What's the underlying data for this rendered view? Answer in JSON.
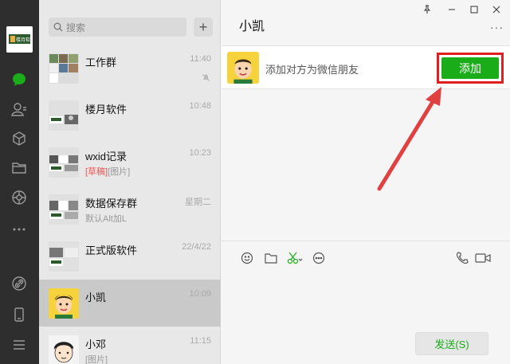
{
  "rail": {
    "logo_text": "楼月软件",
    "icons": [
      "chat-icon",
      "contacts-icon",
      "cube-icon",
      "folder-icon",
      "moments-icon",
      "more-icon",
      "link-icon",
      "phone-icon",
      "menu-icon"
    ]
  },
  "search": {
    "placeholder": "搜索",
    "add": "+"
  },
  "conversations": [
    {
      "name": "工作群",
      "time": "11:40",
      "msg": "",
      "draft": "",
      "muted": true
    },
    {
      "name": "楼月软件",
      "time": "10:48",
      "msg": "",
      "draft": "",
      "muted": false
    },
    {
      "name": "wxid记录",
      "time": "10:23",
      "msg": "[图片]",
      "draft": "[草稿]",
      "muted": false
    },
    {
      "name": "数据保存群",
      "time": "星期二",
      "msg": "默认Alt加L",
      "draft": "",
      "muted": false
    },
    {
      "name": "正式版软件",
      "time": "22/4/22",
      "msg": "",
      "draft": "",
      "muted": false
    },
    {
      "name": "小凯",
      "time": "10:09",
      "msg": "",
      "draft": "",
      "muted": false
    },
    {
      "name": "小邓",
      "time": "11:15",
      "msg": "[图片]",
      "draft": "",
      "muted": false
    }
  ],
  "chat": {
    "title": "小凯",
    "more": "···",
    "banner_text": "添加对方为微信朋友",
    "add_button": "添加",
    "send_button": "发送(S)"
  },
  "colors": {
    "accent": "#1aad19",
    "highlight": "#e0201e",
    "arrow": "#e04040"
  }
}
